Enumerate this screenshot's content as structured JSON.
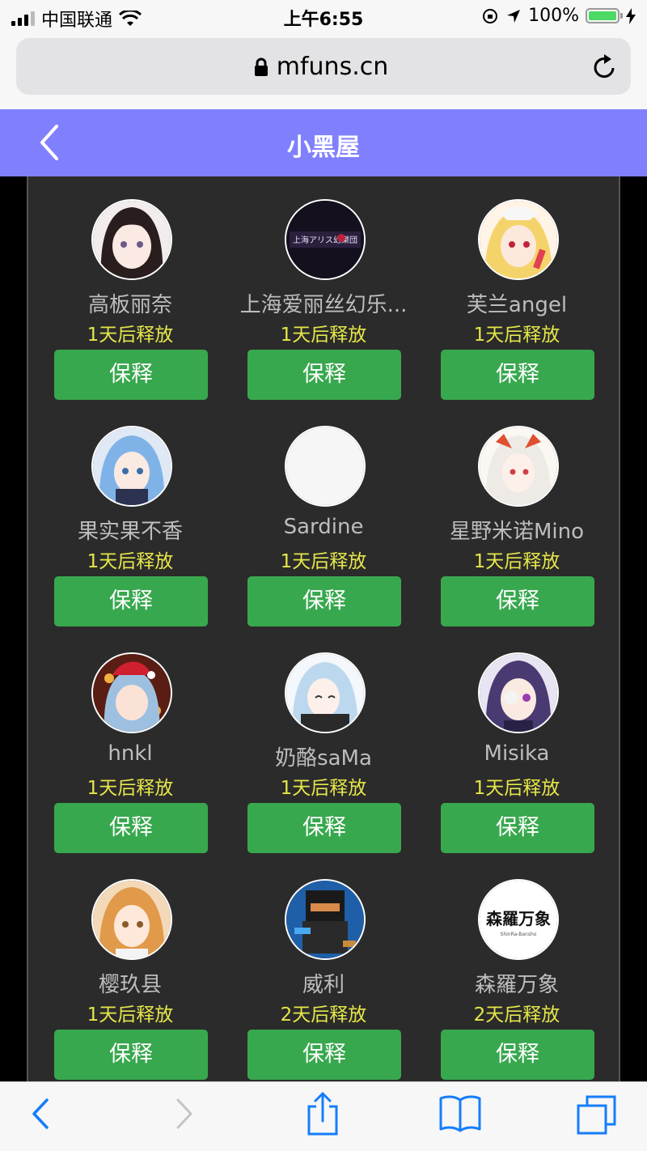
{
  "status_bar": {
    "carrier": "中国联通",
    "time": "上午6:55",
    "battery": "100%",
    "battery_level": 1.0
  },
  "browser": {
    "domain": "mfuns.cn",
    "lock_icon": "lock-icon",
    "reload_icon": "reload-icon"
  },
  "header": {
    "title": "小黑屋",
    "back_icon": "chevron-left-icon",
    "bg_color": "#8080ff"
  },
  "users": [
    {
      "name": "高板丽奈",
      "release": "1天后释放",
      "action": "保释",
      "avatar": "anime-girl-dark-hair"
    },
    {
      "name": "上海爱丽丝幻乐...",
      "release": "1天后释放",
      "action": "保释",
      "avatar": "dark-logo"
    },
    {
      "name": "芙兰angel",
      "release": "1天后释放",
      "action": "保释",
      "avatar": "anime-girl-blonde"
    },
    {
      "name": "果实果不香",
      "release": "1天后释放",
      "action": "保释",
      "avatar": "anime-girl-blue-hair"
    },
    {
      "name": "Sardine",
      "release": "1天后释放",
      "action": "保释",
      "avatar": "blank-white"
    },
    {
      "name": "星野米诺Mino",
      "release": "1天后释放",
      "action": "保释",
      "avatar": "anime-girl-white-hair"
    },
    {
      "name": "hnkl",
      "release": "1天后释放",
      "action": "保释",
      "avatar": "anime-girl-christmas"
    },
    {
      "name": "奶酪saMa",
      "release": "1天后释放",
      "action": "保释",
      "avatar": "anime-girl-light-blue"
    },
    {
      "name": "Misika",
      "release": "1天后释放",
      "action": "保释",
      "avatar": "anime-girl-purple-hair"
    },
    {
      "name": "樱玖县",
      "release": "1天后释放",
      "action": "保释",
      "avatar": "anime-girl-orange-hair"
    },
    {
      "name": "威利",
      "release": "2天后释放",
      "action": "保释",
      "avatar": "pixel-character"
    },
    {
      "name": "森羅万象",
      "release": "2天后释放",
      "action": "保释",
      "avatar": "text-logo",
      "avatar_text": "森羅万象",
      "avatar_subtext": "ShinRa-Bansho"
    }
  ],
  "toolbar": {
    "back_icon": "chevron-left-icon",
    "forward_icon": "chevron-right-icon",
    "share_icon": "share-icon",
    "bookmarks_icon": "book-icon",
    "tabs_icon": "tabs-icon"
  },
  "colors": {
    "accent": "#8080ff",
    "button": "#38a84e",
    "release_text": "#e6e64a",
    "name_text": "#bdbdbd",
    "panel": "#2b2b2b"
  }
}
